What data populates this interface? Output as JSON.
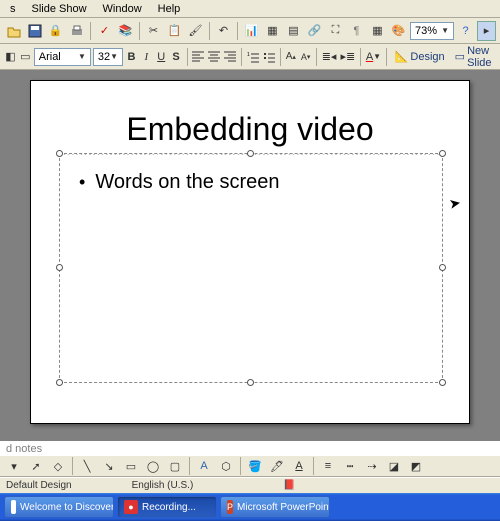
{
  "menu": {
    "items": [
      "s",
      "Slide Show",
      "Window",
      "Help"
    ]
  },
  "toolbar1": {
    "zoom": "73%"
  },
  "toolbar2": {
    "font": "Arial",
    "size": "32",
    "design": "Design",
    "newslide": "New Slide"
  },
  "slide": {
    "title": "Embedding video",
    "bullet1": "Words on the screen"
  },
  "notes": {
    "placeholder": "d notes"
  },
  "status": {
    "design": "Default Design",
    "lang": "English (U.S.)"
  },
  "taskbar": {
    "items": [
      {
        "label": "Welcome to Discovery E...",
        "icon": "🌐"
      },
      {
        "label": "Recording...",
        "icon": "⏺"
      },
      {
        "label": "Microsoft PowerPoint - [...",
        "icon": "📊"
      }
    ]
  }
}
